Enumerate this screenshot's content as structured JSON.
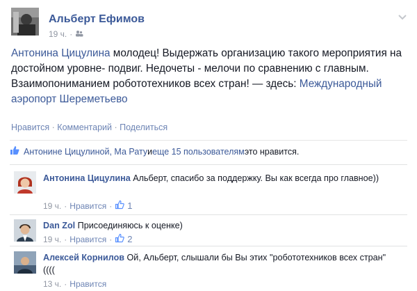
{
  "post": {
    "author": "Альберт Ефимов",
    "time": "19 ч.",
    "privacy_icon": "friends-icon",
    "text_mention": "Антонина Цицулина",
    "text_body": " молодец! Выдержать организацию такого мероприятия на достойном уровне- подвиг. Недочеты - мелочи по сравнению с главным. Взаимопониманием робототехников всех стран! — здесь: ",
    "text_place": "Международный аэропорт Шереметьево",
    "actions": {
      "like": "Нравится",
      "sep1": " · ",
      "comment": "Комментарий",
      "sep2": " · ",
      "share": "Поделиться"
    }
  },
  "likes": {
    "names": "Антонине Цицулиной, Ма Рату",
    "and": " и ",
    "others": "еще 15 пользователям",
    "suffix": " это нравится."
  },
  "comments": [
    {
      "name": "Антонина Цицулина",
      "text": " Альберт, спасибо за поддержку. Вы как всегда про главное))",
      "time": "19 ч.",
      "like": "Нравится",
      "count": "1"
    },
    {
      "name": "Dan Zol",
      "text": " Присоединяюсь к оценке)",
      "time": "19 ч.",
      "like": "Нравится",
      "count": "2"
    },
    {
      "name": "Алексей Корнилов",
      "text": " Ой, Альберт, слышали бы Вы этих \"робототехников всех стран\" ((((",
      "time": "13 ч.",
      "like": "Нравится",
      "count": ""
    }
  ],
  "colors": {
    "link": "#3b5998",
    "meta": "#9197a3",
    "action": "#6d84b4"
  }
}
